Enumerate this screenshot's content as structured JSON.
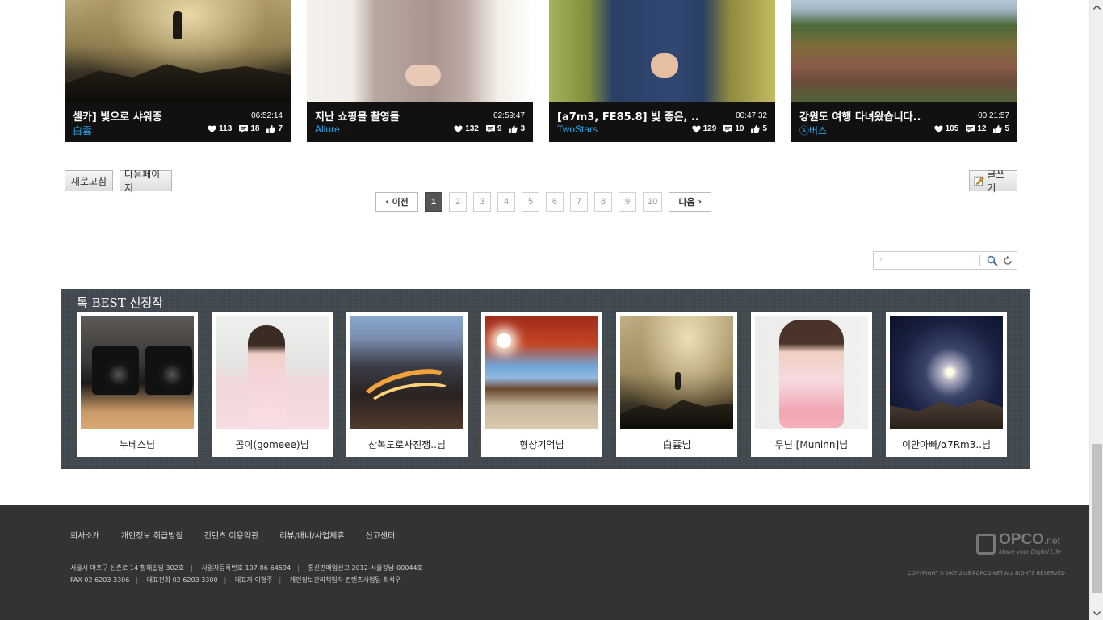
{
  "cards": [
    {
      "title": "셀카] 빛으로 샤워중",
      "time": "06:52:14",
      "author": "白雲",
      "likes": "113",
      "comments": "18",
      "recommends": "7"
    },
    {
      "title": "지난 쇼핑몰 촬영들",
      "time": "02:59:47",
      "author": "Allure",
      "likes": "132",
      "comments": "9",
      "recommends": "3"
    },
    {
      "title": "[a7m3, FE85.8] 빛 좋은, ..",
      "time": "00:47:32",
      "author": "TwoStars",
      "likes": "129",
      "comments": "10",
      "recommends": "5"
    },
    {
      "title": "강원도 여행 다녀왔습니다..",
      "time": "00:21:57",
      "author": "㉦버스",
      "likes": "105",
      "comments": "12",
      "recommends": "5"
    }
  ],
  "buttons": {
    "refresh": "새로고침",
    "next_page": "다음페이지",
    "write": "글쓰기"
  },
  "pagination": {
    "prev": "이전",
    "next": "다음",
    "current": "1",
    "pages": [
      "1",
      "2",
      "3",
      "4",
      "5",
      "6",
      "7",
      "8",
      "9",
      "10"
    ]
  },
  "search": {
    "value": ""
  },
  "best": {
    "title": "톡 BEST 선정작",
    "items": [
      {
        "name": "누베스님"
      },
      {
        "name": "곰이(gomeee)님"
      },
      {
        "name": "산복도로사진쟁..님"
      },
      {
        "name": "형상기억님"
      },
      {
        "name": "白雲님"
      },
      {
        "name": "무닌 [Muninn]님"
      },
      {
        "name": "이안아빠/α7Rm3..님"
      }
    ]
  },
  "footer": {
    "links": [
      "회사소개",
      "개인정보 취급방침",
      "컨텐츠 이용약관",
      "리뷰/배너/사업제휴",
      "신고센터"
    ],
    "address_line1": [
      "서울시 마포구 신촌로 14 황해빌딩 302호",
      "사업자등록번호 107-86-64594",
      "통신판매업신고 2012-서울강남-00044호"
    ],
    "address_line2": [
      "FAX 02 6203 3306",
      "대표전화 02 6203 3300",
      "대표자 이형주",
      "개인정보관리책임자 컨텐츠사업팀 최석우"
    ],
    "copyright": "COPYRIGHT © 2007-2015 POPCO.NET ALL RIGHTS RESERVED",
    "logo_text": "OPCO",
    "logo_suffix": ".net",
    "logo_tagline": "Make your Digital Life"
  }
}
